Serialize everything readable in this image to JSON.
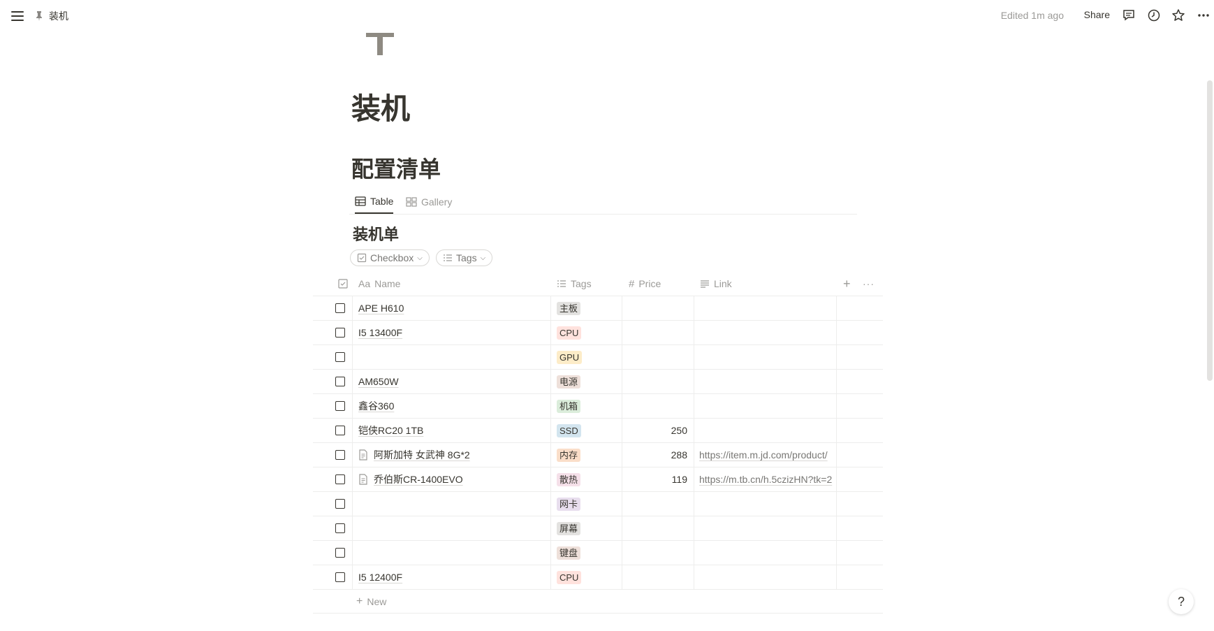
{
  "topbar": {
    "breadcrumb": "装机",
    "edited": "Edited 1m ago",
    "share": "Share"
  },
  "page": {
    "title": "装机",
    "heading": "配置清单"
  },
  "views": [
    {
      "label": "Table",
      "icon": "table-icon",
      "active": true
    },
    {
      "label": "Gallery",
      "icon": "gallery-icon",
      "active": false
    }
  ],
  "database": {
    "title": "装机单",
    "filters": [
      {
        "label": "Checkbox",
        "icon": "checkbox-icon"
      },
      {
        "label": "Tags",
        "icon": "list-icon"
      }
    ],
    "columns": {
      "name": "Name",
      "name_prefix": "Aa",
      "tags": "Tags",
      "price": "Price",
      "price_prefix": "#",
      "link": "Link"
    },
    "rows": [
      {
        "checked": false,
        "name": "APE H610",
        "doc_icon": false,
        "tag": "主板",
        "tag_color": "#e3e2e0",
        "price": "",
        "link": ""
      },
      {
        "checked": false,
        "name": "I5 13400F",
        "doc_icon": false,
        "tag": "CPU",
        "tag_color": "#ffe2dd",
        "price": "",
        "link": ""
      },
      {
        "checked": false,
        "name": "",
        "doc_icon": false,
        "tag": "GPU",
        "tag_color": "#fdecc8",
        "price": "",
        "link": ""
      },
      {
        "checked": false,
        "name": "AM650W",
        "doc_icon": false,
        "tag": "电源",
        "tag_color": "#eee0da",
        "price": "",
        "link": ""
      },
      {
        "checked": false,
        "name": "鑫谷360",
        "doc_icon": false,
        "tag": "机箱",
        "tag_color": "#dbeddb",
        "price": "",
        "link": ""
      },
      {
        "checked": false,
        "name": "铠侠RC20 1TB",
        "doc_icon": false,
        "tag": "SSD",
        "tag_color": "#d3e5ef",
        "price": "250",
        "link": ""
      },
      {
        "checked": false,
        "name": "阿斯加特 女武神 8G*2",
        "doc_icon": true,
        "tag": "内存",
        "tag_color": "#fadec9",
        "price": "288",
        "link": "https://item.m.jd.com/product/"
      },
      {
        "checked": false,
        "name": "乔伯斯CR-1400EVO",
        "doc_icon": true,
        "tag": "散热",
        "tag_color": "#f5e0e9",
        "price": "119",
        "link": "https://m.tb.cn/h.5czizHN?tk=2"
      },
      {
        "checked": false,
        "name": "",
        "doc_icon": false,
        "tag": "网卡",
        "tag_color": "#e8deee",
        "price": "",
        "link": ""
      },
      {
        "checked": false,
        "name": "",
        "doc_icon": false,
        "tag": "屏幕",
        "tag_color": "#e3e2e0",
        "price": "",
        "link": ""
      },
      {
        "checked": false,
        "name": "",
        "doc_icon": false,
        "tag": "键盘",
        "tag_color": "#eee0da",
        "price": "",
        "link": ""
      },
      {
        "checked": false,
        "name": "I5 12400F",
        "doc_icon": false,
        "tag": "CPU",
        "tag_color": "#ffe2dd",
        "price": "",
        "link": ""
      }
    ],
    "new_label": "New"
  },
  "help": "?"
}
